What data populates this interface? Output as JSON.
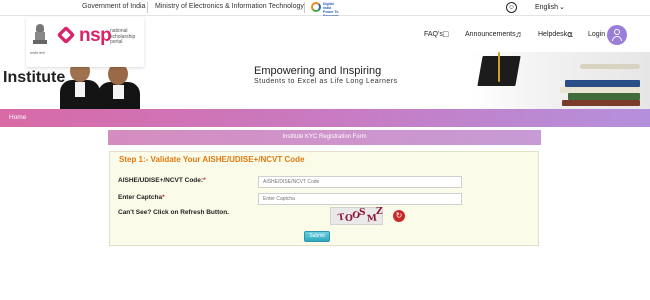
{
  "topbar": {
    "gov_of_india": "Government of India",
    "ministry": "Ministry of Electronics & Information Technology",
    "digital_india_line1": "Digital India",
    "digital_india_line2": "Power To Empower",
    "accessibility_icon": "accessibility-icon",
    "language": "English",
    "language_icon": "chevron-down-icon"
  },
  "logo": {
    "emblem_caption": "सत्यमेव जयते",
    "brand": "nsp",
    "brand_sub": "national scholarship portal"
  },
  "nav": {
    "faqs": "FAQ's",
    "faqs_icon": "chat-bubble-icon",
    "announcements": "Announcements",
    "announcements_icon": "speaker-icon",
    "helpdesk": "Helpdesk",
    "helpdesk_icon": "headset-icon",
    "login": "Login",
    "login_icon": "user-avatar-icon"
  },
  "banner": {
    "page_heading": "Institute",
    "tagline_main": "Empowering and Inspiring",
    "tagline_sub": "Students to Excel as Life Long Learners"
  },
  "menu": {
    "home": "Home"
  },
  "form": {
    "title": "Institute KYC Registration Form",
    "step_title": "Step 1:- Validate Your AISHE/UDISE+/NCVT Code",
    "code_label": "AISHE/UDISE+/NCVT Code:",
    "code_placeholder": "AISHE/DISE/NCVT Code",
    "captcha_label": "Enter Captcha",
    "captcha_placeholder": "Enter Captcha",
    "refresh_hint": "Can't See? Click on Refresh Button.",
    "captcha_text": "TOOSMZ",
    "refresh_icon": "refresh-icon",
    "submit": "Submit"
  },
  "colors": {
    "brand_pink": "#d9246b",
    "step_orange": "#e07a10",
    "required_red": "#d21c1c",
    "panel_bg": "#fbfbe9",
    "menu_gradient_start": "#d86aa6",
    "menu_gradient_end": "#b490dc",
    "submit_blue": "#2fa8c0"
  }
}
